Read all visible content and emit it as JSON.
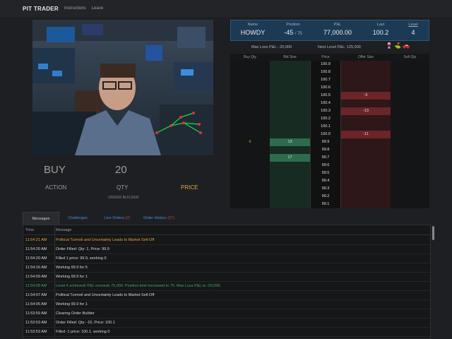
{
  "app": {
    "title": "PIT TRADER",
    "nav": [
      "Instructions",
      "Leave"
    ]
  },
  "order_builder": {
    "side": "BUY",
    "qty": "20",
    "action_label": "ACTION",
    "qty_label": "QTY",
    "price_label": "PRICE",
    "caption": "ORDER BUILDER"
  },
  "position": {
    "name_header": "Name",
    "name": "HOWDY",
    "position_header": "Position",
    "position_value": "-45",
    "position_limit": "/ 75",
    "pnl_header": "P&L",
    "pnl": "77,000.00",
    "last_header": "Last",
    "last": "100.2",
    "level_header": "Level",
    "level": "4"
  },
  "limits": {
    "max_loss": "Max Loss P&L: -20,000",
    "next_level": "Next Level P&L: 125,000"
  },
  "ladder": {
    "headers": [
      "Buy Qty",
      "Bid Size",
      "Price",
      "Offer Size",
      "Sell Qty"
    ],
    "rows": [
      {
        "buy_qty": "",
        "bid_size": "",
        "price": "100.9",
        "offer_size": "",
        "sell_qty": ""
      },
      {
        "buy_qty": "",
        "bid_size": "",
        "price": "100.8",
        "offer_size": "",
        "sell_qty": ""
      },
      {
        "buy_qty": "",
        "bid_size": "",
        "price": "100.7",
        "offer_size": "",
        "sell_qty": ""
      },
      {
        "buy_qty": "",
        "bid_size": "",
        "price": "100.6",
        "offer_size": "",
        "sell_qty": ""
      },
      {
        "buy_qty": "",
        "bid_size": "",
        "price": "100.5",
        "offer_size": "-5",
        "sell_qty": ""
      },
      {
        "buy_qty": "",
        "bid_size": "",
        "price": "100.4",
        "offer_size": "",
        "sell_qty": ""
      },
      {
        "buy_qty": "",
        "bid_size": "",
        "price": "100.3",
        "offer_size": "-13",
        "sell_qty": ""
      },
      {
        "buy_qty": "",
        "bid_size": "",
        "price": "100.2",
        "offer_size": "",
        "sell_qty": ""
      },
      {
        "buy_qty": "",
        "bid_size": "",
        "price": "100.1",
        "offer_size": "",
        "sell_qty": ""
      },
      {
        "buy_qty": "",
        "bid_size": "",
        "price": "100.0",
        "offer_size": "-11",
        "sell_qty": ""
      },
      {
        "buy_qty": "6",
        "bid_size": "13",
        "price": "99.9",
        "offer_size": "",
        "sell_qty": ""
      },
      {
        "buy_qty": "",
        "bid_size": "",
        "price": "99.8",
        "offer_size": "",
        "sell_qty": ""
      },
      {
        "buy_qty": "",
        "bid_size": "17",
        "price": "99.7",
        "offer_size": "",
        "sell_qty": ""
      },
      {
        "buy_qty": "",
        "bid_size": "",
        "price": "99.6",
        "offer_size": "",
        "sell_qty": ""
      },
      {
        "buy_qty": "",
        "bid_size": "",
        "price": "99.5",
        "offer_size": "",
        "sell_qty": ""
      },
      {
        "buy_qty": "",
        "bid_size": "",
        "price": "99.4",
        "offer_size": "",
        "sell_qty": ""
      },
      {
        "buy_qty": "",
        "bid_size": "",
        "price": "99.3",
        "offer_size": "",
        "sell_qty": ""
      },
      {
        "buy_qty": "",
        "bid_size": "",
        "price": "99.2",
        "offer_size": "",
        "sell_qty": ""
      },
      {
        "buy_qty": "",
        "bid_size": "",
        "price": "99.1",
        "offer_size": "",
        "sell_qty": ""
      }
    ]
  },
  "tabs": [
    {
      "label": "Messages",
      "badge": ""
    },
    {
      "label": "Challenges",
      "badge": ""
    },
    {
      "label": "Live Orders",
      "badge": "(2)"
    },
    {
      "label": "Order History",
      "badge": "(27)"
    }
  ],
  "messages": {
    "headers": {
      "time": "Time",
      "message": "Message"
    },
    "rows": [
      {
        "time": "11:54:21 AM",
        "text": "Political Turmoil and Uncertainty Leads to Market Sell-Off",
        "kind": "news"
      },
      {
        "time": "11:54:20 AM",
        "text": "Order Filled: Qty: 1, Price: 99.9",
        "kind": "normal"
      },
      {
        "time": "11:54:20 AM",
        "text": "Filled 1 price: 99.9, working 0",
        "kind": "normal"
      },
      {
        "time": "11:54:16 AM",
        "text": "Working 99.9 for 5",
        "kind": "normal"
      },
      {
        "time": "11:54:09 AM",
        "text": "Working 99.9 for 1",
        "kind": "normal"
      },
      {
        "time": "11:54:08 AM",
        "text": "Level 4 achieved! P&L exceeds 75,000. Position limit increased to 75. Max Loss P&L to -20,000.",
        "kind": "level"
      },
      {
        "time": "11:54:07 AM",
        "text": "Political Turmoil and Uncertainty Leads to Market Sell-Off",
        "kind": "normal"
      },
      {
        "time": "11:54:05 AM",
        "text": "Working 99.9 for 1",
        "kind": "normal"
      },
      {
        "time": "11:53:59 AM",
        "text": "Clearing Order Builder",
        "kind": "normal"
      },
      {
        "time": "11:53:53 AM",
        "text": "Order Filled: Qty: -10, Price: 100.1",
        "kind": "normal"
      },
      {
        "time": "11:53:53 AM",
        "text": "Filled -1 price: 100.1, working 0",
        "kind": "normal"
      }
    ]
  },
  "colors": {
    "news": "#e0a43a",
    "level": "#3aa76d",
    "normal": "#d8d8d8",
    "price_accent": "#e0a43a",
    "link": "#4a8fd8"
  },
  "icons": [
    "wine-glass-icon",
    "flag-icon",
    "car-icon"
  ]
}
